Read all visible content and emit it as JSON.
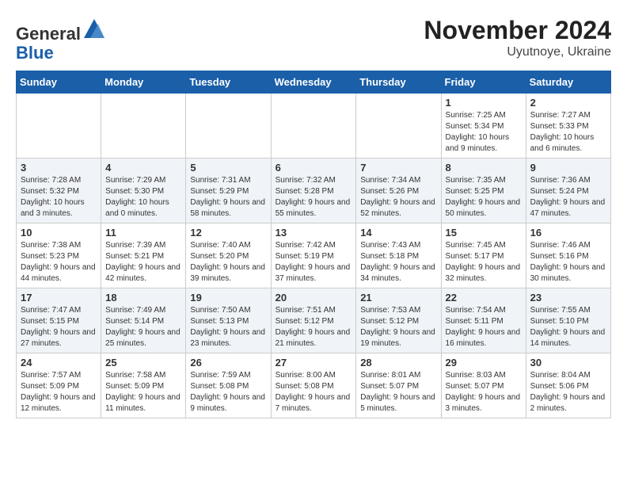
{
  "header": {
    "logo_general": "General",
    "logo_blue": "Blue",
    "month": "November 2024",
    "location": "Uyutnoye, Ukraine"
  },
  "days_of_week": [
    "Sunday",
    "Monday",
    "Tuesday",
    "Wednesday",
    "Thursday",
    "Friday",
    "Saturday"
  ],
  "weeks": [
    [
      {
        "day": "",
        "info": ""
      },
      {
        "day": "",
        "info": ""
      },
      {
        "day": "",
        "info": ""
      },
      {
        "day": "",
        "info": ""
      },
      {
        "day": "",
        "info": ""
      },
      {
        "day": "1",
        "info": "Sunrise: 7:25 AM\nSunset: 5:34 PM\nDaylight: 10 hours and 9 minutes."
      },
      {
        "day": "2",
        "info": "Sunrise: 7:27 AM\nSunset: 5:33 PM\nDaylight: 10 hours and 6 minutes."
      }
    ],
    [
      {
        "day": "3",
        "info": "Sunrise: 7:28 AM\nSunset: 5:32 PM\nDaylight: 10 hours and 3 minutes."
      },
      {
        "day": "4",
        "info": "Sunrise: 7:29 AM\nSunset: 5:30 PM\nDaylight: 10 hours and 0 minutes."
      },
      {
        "day": "5",
        "info": "Sunrise: 7:31 AM\nSunset: 5:29 PM\nDaylight: 9 hours and 58 minutes."
      },
      {
        "day": "6",
        "info": "Sunrise: 7:32 AM\nSunset: 5:28 PM\nDaylight: 9 hours and 55 minutes."
      },
      {
        "day": "7",
        "info": "Sunrise: 7:34 AM\nSunset: 5:26 PM\nDaylight: 9 hours and 52 minutes."
      },
      {
        "day": "8",
        "info": "Sunrise: 7:35 AM\nSunset: 5:25 PM\nDaylight: 9 hours and 50 minutes."
      },
      {
        "day": "9",
        "info": "Sunrise: 7:36 AM\nSunset: 5:24 PM\nDaylight: 9 hours and 47 minutes."
      }
    ],
    [
      {
        "day": "10",
        "info": "Sunrise: 7:38 AM\nSunset: 5:23 PM\nDaylight: 9 hours and 44 minutes."
      },
      {
        "day": "11",
        "info": "Sunrise: 7:39 AM\nSunset: 5:21 PM\nDaylight: 9 hours and 42 minutes."
      },
      {
        "day": "12",
        "info": "Sunrise: 7:40 AM\nSunset: 5:20 PM\nDaylight: 9 hours and 39 minutes."
      },
      {
        "day": "13",
        "info": "Sunrise: 7:42 AM\nSunset: 5:19 PM\nDaylight: 9 hours and 37 minutes."
      },
      {
        "day": "14",
        "info": "Sunrise: 7:43 AM\nSunset: 5:18 PM\nDaylight: 9 hours and 34 minutes."
      },
      {
        "day": "15",
        "info": "Sunrise: 7:45 AM\nSunset: 5:17 PM\nDaylight: 9 hours and 32 minutes."
      },
      {
        "day": "16",
        "info": "Sunrise: 7:46 AM\nSunset: 5:16 PM\nDaylight: 9 hours and 30 minutes."
      }
    ],
    [
      {
        "day": "17",
        "info": "Sunrise: 7:47 AM\nSunset: 5:15 PM\nDaylight: 9 hours and 27 minutes."
      },
      {
        "day": "18",
        "info": "Sunrise: 7:49 AM\nSunset: 5:14 PM\nDaylight: 9 hours and 25 minutes."
      },
      {
        "day": "19",
        "info": "Sunrise: 7:50 AM\nSunset: 5:13 PM\nDaylight: 9 hours and 23 minutes."
      },
      {
        "day": "20",
        "info": "Sunrise: 7:51 AM\nSunset: 5:12 PM\nDaylight: 9 hours and 21 minutes."
      },
      {
        "day": "21",
        "info": "Sunrise: 7:53 AM\nSunset: 5:12 PM\nDaylight: 9 hours and 19 minutes."
      },
      {
        "day": "22",
        "info": "Sunrise: 7:54 AM\nSunset: 5:11 PM\nDaylight: 9 hours and 16 minutes."
      },
      {
        "day": "23",
        "info": "Sunrise: 7:55 AM\nSunset: 5:10 PM\nDaylight: 9 hours and 14 minutes."
      }
    ],
    [
      {
        "day": "24",
        "info": "Sunrise: 7:57 AM\nSunset: 5:09 PM\nDaylight: 9 hours and 12 minutes."
      },
      {
        "day": "25",
        "info": "Sunrise: 7:58 AM\nSunset: 5:09 PM\nDaylight: 9 hours and 11 minutes."
      },
      {
        "day": "26",
        "info": "Sunrise: 7:59 AM\nSunset: 5:08 PM\nDaylight: 9 hours and 9 minutes."
      },
      {
        "day": "27",
        "info": "Sunrise: 8:00 AM\nSunset: 5:08 PM\nDaylight: 9 hours and 7 minutes."
      },
      {
        "day": "28",
        "info": "Sunrise: 8:01 AM\nSunset: 5:07 PM\nDaylight: 9 hours and 5 minutes."
      },
      {
        "day": "29",
        "info": "Sunrise: 8:03 AM\nSunset: 5:07 PM\nDaylight: 9 hours and 3 minutes."
      },
      {
        "day": "30",
        "info": "Sunrise: 8:04 AM\nSunset: 5:06 PM\nDaylight: 9 hours and 2 minutes."
      }
    ]
  ]
}
